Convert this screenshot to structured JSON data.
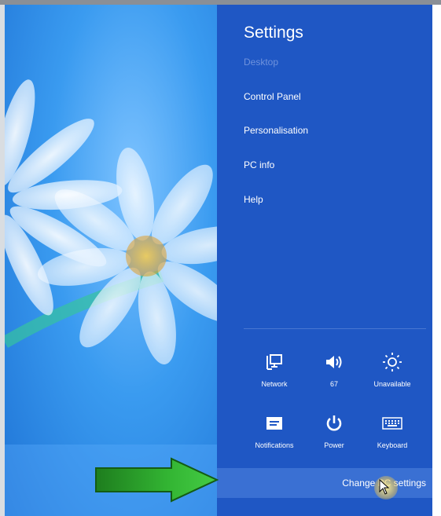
{
  "charm": {
    "title": "Settings",
    "items": [
      {
        "label": "Desktop",
        "enabled": false
      },
      {
        "label": "Control Panel",
        "enabled": true
      },
      {
        "label": "Personalisation",
        "enabled": true
      },
      {
        "label": "PC info",
        "enabled": true
      },
      {
        "label": "Help",
        "enabled": true
      }
    ],
    "quick_settings": [
      {
        "label": "Network",
        "icon": "network-icon"
      },
      {
        "label": "67",
        "icon": "volume-icon"
      },
      {
        "label": "Unavailable",
        "icon": "brightness-icon"
      },
      {
        "label": "Notifications",
        "icon": "notifications-icon"
      },
      {
        "label": "Power",
        "icon": "power-icon"
      },
      {
        "label": "Keyboard",
        "icon": "keyboard-icon"
      }
    ],
    "change_pc_settings": "Change PC settings",
    "background_color": "#1f57c4",
    "disabled_text_color": "#6f92dc"
  },
  "annotation": {
    "arrow_color": "#2fae2f",
    "arrow_icon": "green-arrow-icon"
  },
  "desktop": {
    "wallpaper": "blue daisy wallpaper"
  }
}
